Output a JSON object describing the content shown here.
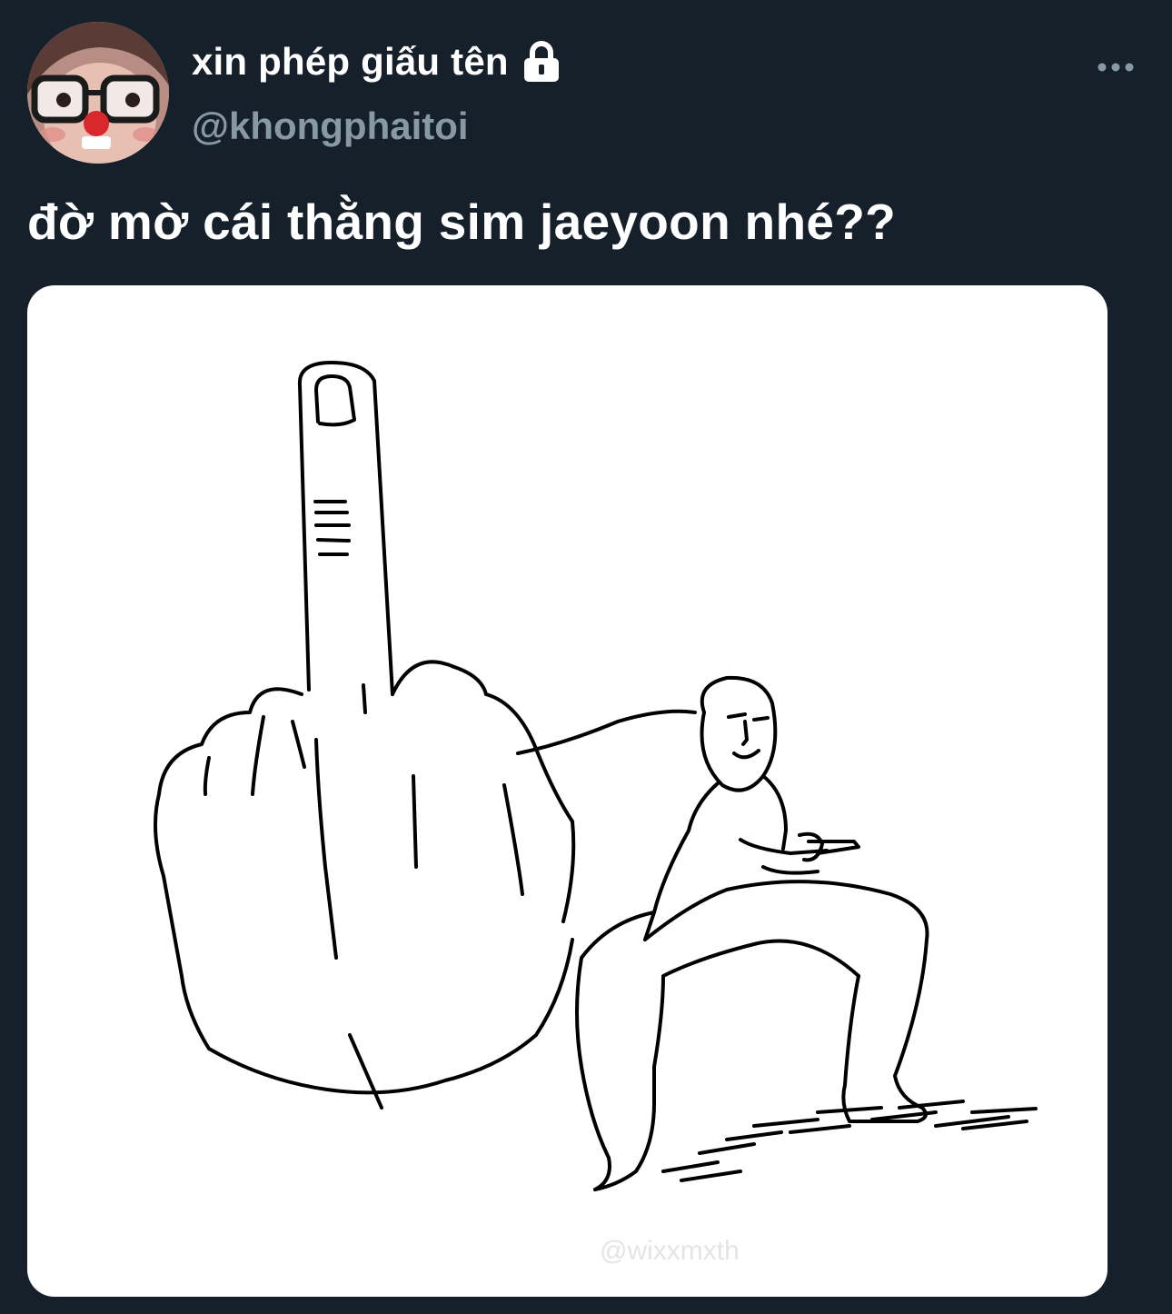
{
  "tweet": {
    "author": {
      "display_name": "xin phép giấu tên",
      "handle": "@khongphaitoi",
      "avatar_icon": "profile-avatar",
      "protected_icon": "lock-icon"
    },
    "more_icon": "more-dots-icon",
    "text": "đờ mờ cái thằng sim jaeyoon nhé??",
    "media": {
      "type": "image",
      "description_icon": "middle-finger-meme-drawing",
      "watermark": "@wixxmxth"
    }
  },
  "colors": {
    "background": "#15202b",
    "primary_text": "#ffffff",
    "secondary_text": "#8899a6",
    "media_background": "#ffffff",
    "drawing_ink": "#000000"
  }
}
